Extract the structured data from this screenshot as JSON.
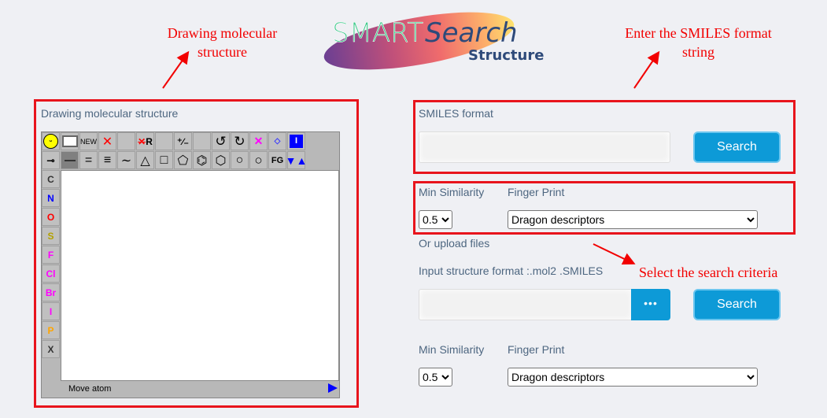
{
  "logo": {
    "smart": "SMART",
    "search": "Search",
    "structure": "Structure"
  },
  "annotations": {
    "drawing": "Drawing molecular structure",
    "smiles": "Enter the SMILES format string",
    "criteria": "Select  the search criteria"
  },
  "editor": {
    "title": "Drawing molecular structure",
    "status": "Move atom",
    "new_label": "NEW",
    "fg_label": "FG",
    "atoms": [
      {
        "s": "C",
        "c": "#333333"
      },
      {
        "s": "N",
        "c": "#0000ff"
      },
      {
        "s": "O",
        "c": "#ff0000"
      },
      {
        "s": "S",
        "c": "#b3a100"
      },
      {
        "s": "F",
        "c": "#ff00ff"
      },
      {
        "s": "Cl",
        "c": "#ff00ff"
      },
      {
        "s": "Br",
        "c": "#ff00ff"
      },
      {
        "s": "I",
        "c": "#ff00ff"
      },
      {
        "s": "P",
        "c": "#ffa500"
      },
      {
        "s": "X",
        "c": "#333333"
      }
    ]
  },
  "smiles": {
    "label": "SMILES format",
    "value": "",
    "search": "Search"
  },
  "criteria1": {
    "sim_label": "Min Similarity",
    "sim_value": "0.5",
    "fp_label": "Finger Print",
    "fp_value": "Dragon descriptors"
  },
  "upload": {
    "or": "Or upload files",
    "label": "Input structure format :.mol2 .SMILES",
    "browse": "•••",
    "search": "Search"
  },
  "criteria2": {
    "sim_label": "Min Similarity",
    "sim_value": "0.5",
    "fp_label": "Finger Print",
    "fp_value": "Dragon descriptors"
  }
}
